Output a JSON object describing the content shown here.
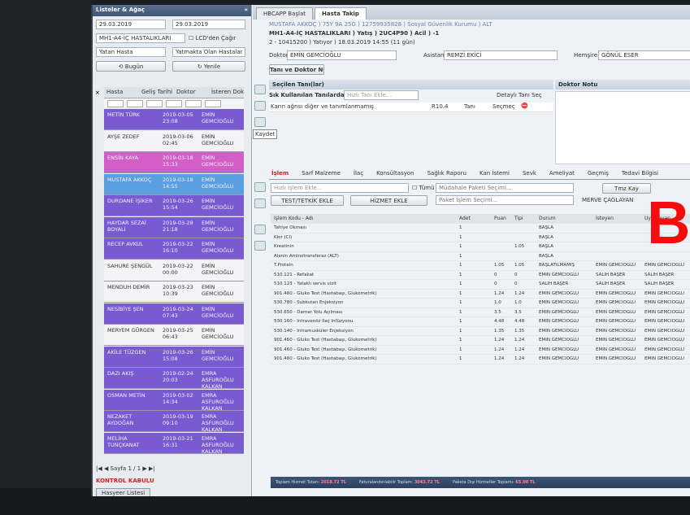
{
  "left": {
    "title": "Listeler & Ağaç",
    "date_from": "29.03.2019",
    "date_to": "29.03.2019",
    "clinic": "MH1-A4-İÇ HASTALIKLARI",
    "lcd_call": "LCD'den Çağır",
    "patient_type": "Yatan Hasta",
    "patient_state": "Yatmakta Olan Hastalar",
    "today_btn": "Bugün",
    "refresh_btn": "Yenile",
    "columns": [
      "Hasta",
      "Geliş Tarihi",
      "Doktor",
      "İsteren Dok."
    ],
    "patients": [
      {
        "name": "METİN TÜRK",
        "date": "2019-03-05 23:08",
        "doctor": "EMİN GEMCİOĞLU",
        "color": "#7a5ad0"
      },
      {
        "name": "AYŞE ZEDEF",
        "date": "2019-03-06 02:45",
        "doctor": "EMİN GEMCİOĞLU",
        "color": "#f4f4f6"
      },
      {
        "name": "ENSİN KAYA",
        "date": "2019-03-18 15:33",
        "doctor": "EMİN GEMCİOĞLU",
        "color": "#d25ec6"
      },
      {
        "name": "MUSTAFA AKKOÇ",
        "date": "2019-03-18 14:55",
        "doctor": "EMİN GEMCİOĞLU",
        "color": "#5b9fe0"
      },
      {
        "name": "DURDANE İŞİKER",
        "date": "2019-03-26 15:54",
        "doctor": "EMİN GEMCİOĞLU",
        "color": "#7a5ad0"
      },
      {
        "name": "HAYDAR SEZAİ BOYALI",
        "date": "2019-03-28 21:18",
        "doctor": "EMİN GEMCİOĞLU",
        "color": "#7a5ad0"
      },
      {
        "name": "RECEP AVKUL",
        "date": "2019-03-22 16:10",
        "doctor": "EMİN GEMCİOĞLU",
        "color": "#7a5ad0"
      },
      {
        "name": "SAHURE ŞENGÜL",
        "date": "2019-03-22 00:00",
        "doctor": "EMİN GEMCİOĞLU",
        "color": "#f4f4f6"
      },
      {
        "name": "MENDUH DEMİR",
        "date": "2019-03-23 10:39",
        "doctor": "EMİN GEMCİOĞLU",
        "color": "#f4f4f6"
      },
      {
        "name": "NESİBİYE ŞEN",
        "date": "2019-03-24 07:43",
        "doctor": "EMİN GEMCİOĞLU",
        "color": "#7a5ad0"
      },
      {
        "name": "MERYEM GÜRGEN",
        "date": "2019-03-25 06:43",
        "doctor": "EMİN GEMCİOĞLU",
        "color": "#f4f4f6"
      },
      {
        "name": "AKİLE TÜZGEN",
        "date": "2019-03-26 15:08",
        "doctor": "EMİN GEMCİOĞLU",
        "color": "#7a5ad0"
      },
      {
        "name": "DAZI AKIŞ",
        "date": "2019-02-24 20:03",
        "doctor": "EMRA ASFUROĞLU KALKAN",
        "color": "#7a5ad0"
      },
      {
        "name": "OSMAN METİN",
        "date": "2019-03-02 14:34",
        "doctor": "EMRA ASFUROĞLU KALKAN",
        "color": "#7a5ad0"
      },
      {
        "name": "NEZAKET AYDOĞAN",
        "date": "2019-03-19 09:10",
        "doctor": "EMRA ASFUROĞLU KALKAN",
        "color": "#7a5ad0"
      },
      {
        "name": "MELİHA TUNÇKANAT",
        "date": "2019-03-21 16:31",
        "doctor": "EMRA ASFUROĞLU KALKAN",
        "color": "#7a5ad0"
      }
    ],
    "page_label": "Sayfa",
    "page_value": "1 / 1",
    "kontrol": "KONTROL KABULÜ",
    "list_tab": "Hasyeer Listesi"
  },
  "tabs": [
    "HBCAPP Başlat",
    "Hasta Takip"
  ],
  "patient": {
    "name_line": "MUSTAFA AKKOÇ ) 75Y 9A 25G ) 12759935828 ) Sosyal Güvenlik Kurumu ) ALT",
    "clinic_line": "MH1-A4-İÇ HASTALIKLARI ) Yatış ) 2UC4P90 ) Acil ) -1",
    "visit_line": "2 - 10415200 ) Yatıyor ) 18.03.2019 14:55 (11 gün)"
  },
  "doctor": {
    "label": "Doktor:",
    "value": "EMİN GEMCİOĞLU",
    "assistant_label": "Asistan:",
    "assistant_value": "REMZİ EKİCİ",
    "nurse_label": "Hemşire:",
    "nurse_value": "GÖNÜL ESER"
  },
  "sections": {
    "tani_tab": "Tanı ve Doktor Notu",
    "secilen": "Seçilen Tanı(lar)",
    "doktor_notu": "Doktor Notu",
    "sik": "Sık Kullanılan Tanılarda Ara",
    "tani_placeholder": "Hızlı Tanı Ekle...",
    "detay": "Detaylı Tanı Seç",
    "diag_text": "Karın ağrısı diğer ve tanımlanmamış",
    "diag_code": "R10.4",
    "diag_type": "Tanı",
    "diag_sel": "Seçmeç",
    "kaydet": "Kaydet"
  },
  "subtabs": [
    "İşlem",
    "Sarf Malzeme",
    "İlaç",
    "Konsültasyon",
    "Sağlık Raporu",
    "Kan İstemi",
    "Sevk",
    "Ameliyat",
    "Geçmiş",
    "Tedavi Bilgisi"
  ],
  "islem": {
    "placeholder": "Hızlı İşlem Ekle...",
    "tumu": "Tümü",
    "paket": "Müdahale Paketi Seçimi...",
    "paket2": "Paket İşlem Seçimi...",
    "test_btn": "TEST/TETKİK EKLE",
    "hizmet_btn": "HİZMET EKLE",
    "doctor_sel": "MERVE ÇAĞLAYAN",
    "tmz": "Tmz Kay"
  },
  "table": {
    "headers": [
      "İşlem Kodu - Adı",
      "Adet",
      "Puan",
      "Tipi",
      "Durum",
      "İsteyen",
      "Uygulayan"
    ],
    "rows": [
      [
        "Tahlye Okması",
        "1",
        "",
        "",
        "BAŞLA",
        "",
        ""
      ],
      [
        "Klor (Cl)",
        "1",
        "",
        "",
        "BAŞLA",
        "",
        ""
      ],
      [
        "Kreatinin",
        "1",
        "",
        "1.05",
        "BAŞLA",
        "",
        ""
      ],
      [
        "Alanin Aminotransferaz (ALT)",
        "1",
        "",
        "",
        "BAŞLA",
        "",
        ""
      ],
      [
        "T.Protein",
        "1",
        "1.05",
        "1.05",
        "BAŞLATILMAMIŞ",
        "EMİN GEMCİOĞLU",
        "EMİN GEMCİOĞLU"
      ],
      [
        "510.121 - Refakat",
        "1",
        "0",
        "0",
        "EMİN GEMCİOĞLU",
        "SALİH BAŞER",
        "SALİH BAŞER"
      ],
      [
        "510.123 - Yataklı servis vizit",
        "1",
        "0",
        "0",
        "SALİH BAŞER",
        "SALİH BAŞER",
        "SALİH BAŞER"
      ],
      [
        "901.460 - Gluko Test (Hastabaşı, Glukometrik)",
        "1",
        "1.24",
        "1.24",
        "EMİN GEMCİOĞLU",
        "EMİN GEMCİOĞLU",
        "EMİN GEMCİOĞLU"
      ],
      [
        "530.780 - Subkutan Enjeksiyon",
        "1",
        "1.0",
        "1.0",
        "EMİN GEMCİOĞLU",
        "EMİN GEMCİOĞLU",
        "EMİN GEMCİOĞLU"
      ],
      [
        "530.650 - Damar Yolu Açılması",
        "1",
        "3.5",
        "3.5",
        "EMİN GEMCİOĞLU",
        "EMİN GEMCİOĞLU",
        "EMİN GEMCİOĞLU"
      ],
      [
        "530.160 - İntravenöz İlaç İnfüzyonu",
        "1",
        "4.48",
        "4.48",
        "EMİN GEMCİOĞLU",
        "EMİN GEMCİOĞLU",
        "EMİN GEMCİOĞLU"
      ],
      [
        "530.140 - İntramusküler Enjeksiyon",
        "1",
        "1.35",
        "1.35",
        "EMİN GEMCİOĞLU",
        "EMİN GEMCİOĞLU",
        "EMİN GEMCİOĞLU"
      ],
      [
        "901.460 - Gluko Test (Hastabaşı, Glukometrik)",
        "1",
        "1.24",
        "1.24",
        "EMİN GEMCİOĞLU",
        "EMİN GEMCİOĞLU",
        "EMİN GEMCİOĞLU"
      ],
      [
        "901.460 - Gluko Test (Hastabaşı, Glukometrik)",
        "1",
        "1.24",
        "1.24",
        "EMİN GEMCİOĞLU",
        "EMİN GEMCİOĞLU",
        "EMİN GEMCİOĞLU"
      ],
      [
        "901.460 - Gluko Test (Hastabaşı, Glukometrik)",
        "1",
        "1.24",
        "1.24",
        "EMİN GEMCİOĞLU",
        "EMİN GEMCİOĞLU",
        "EMİN GEMCİOĞLU"
      ]
    ]
  },
  "overlay": "BİLG",
  "status": {
    "a": "Toplam Hizmet Tutarı:",
    "av": "2018.72 TL",
    "b": "Faturalandırılabilir Toplam:",
    "bv": "3043.72 TL",
    "c": "Paketa Dışı Hizmetler Toplamı:",
    "cv": "65.00 TL"
  }
}
